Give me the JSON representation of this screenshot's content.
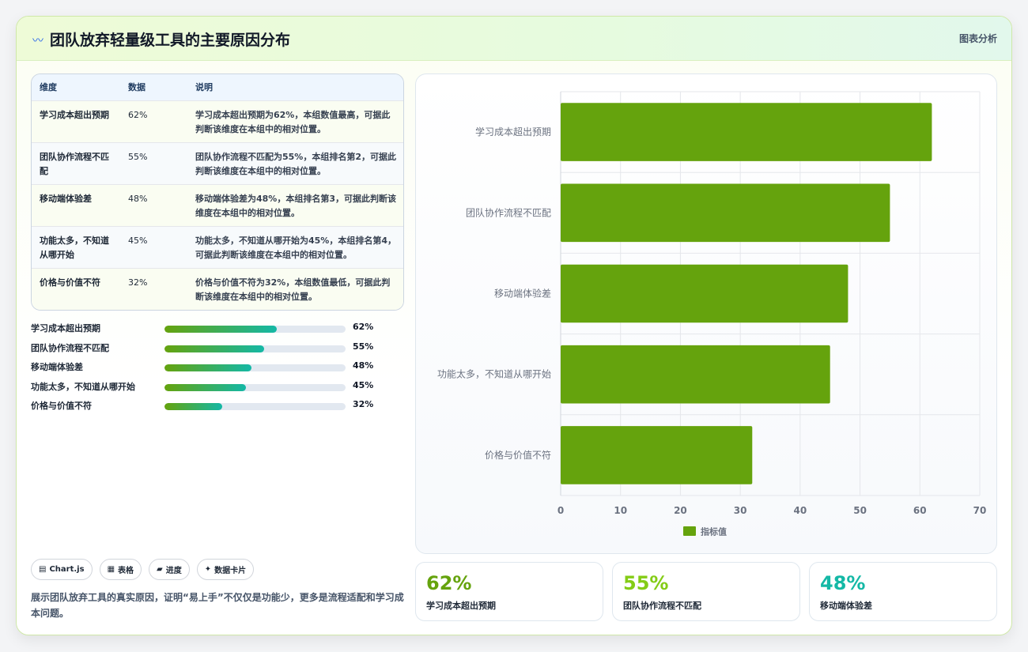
{
  "header": {
    "icon": "〰",
    "title": "团队放弃轻量级工具的主要原因分布",
    "tag": "图表分析"
  },
  "table": {
    "headers": [
      "维度",
      "数据",
      "说明"
    ],
    "rows": [
      {
        "dim": "学习成本超出预期",
        "value": "62%",
        "note": "学习成本超出预期为62%，本组数值最高，可据此判断该维度在本组中的相对位置。"
      },
      {
        "dim": "团队协作流程不匹配",
        "value": "55%",
        "note": "团队协作流程不匹配为55%，本组排名第2，可据此判断该维度在本组中的相对位置。"
      },
      {
        "dim": "移动端体验差",
        "value": "48%",
        "note": "移动端体验差为48%，本组排名第3，可据此判断该维度在本组中的相对位置。"
      },
      {
        "dim": "功能太多，不知道从哪开始",
        "value": "45%",
        "note": "功能太多，不知道从哪开始为45%，本组排名第4，可据此判断该维度在本组中的相对位置。"
      },
      {
        "dim": "价格与价值不符",
        "value": "32%",
        "note": "价格与价值不符为32%，本组数值最低，可据此判断该维度在本组中的相对位置。"
      }
    ]
  },
  "progress": [
    {
      "label": "学习成本超出预期",
      "percent": 62,
      "text": "62%"
    },
    {
      "label": "团队协作流程不匹配",
      "percent": 55,
      "text": "55%"
    },
    {
      "label": "移动端体验差",
      "percent": 48,
      "text": "48%"
    },
    {
      "label": "功能太多，不知道从哪开始",
      "percent": 45,
      "text": "45%"
    },
    {
      "label": "价格与价值不符",
      "percent": 32,
      "text": "32%"
    }
  ],
  "badges": [
    {
      "icon": "▤",
      "label": "Chart.js"
    },
    {
      "icon": "▦",
      "label": "表格"
    },
    {
      "icon": "▰",
      "label": "进度"
    },
    {
      "icon": "✦",
      "label": "数据卡片"
    }
  ],
  "description": "展示团队放弃工具的真实原因，证明“易上手”不仅仅是功能少，更多是流程适配和学习成本问题。",
  "stats": [
    {
      "value": "62%",
      "label": "学习成本超出预期",
      "color": "#65a30d"
    },
    {
      "value": "55%",
      "label": "团队协作流程不匹配",
      "color": "#84cc16"
    },
    {
      "value": "48%",
      "label": "移动端体验差",
      "color": "#14b8a6"
    }
  ],
  "chart_data": {
    "type": "bar",
    "orientation": "horizontal",
    "categories": [
      "学习成本超出预期",
      "团队协作流程不匹配",
      "移动端体验差",
      "功能太多，不知道从哪开始",
      "价格与价值不符"
    ],
    "series": [
      {
        "name": "指标值",
        "values": [
          62,
          55,
          48,
          45,
          32
        ],
        "color": "#65a30d"
      }
    ],
    "xlim": [
      0,
      70
    ],
    "xticks": [
      0,
      10,
      20,
      30,
      40,
      50,
      60,
      70
    ],
    "grid": true,
    "legend": "bottom"
  }
}
